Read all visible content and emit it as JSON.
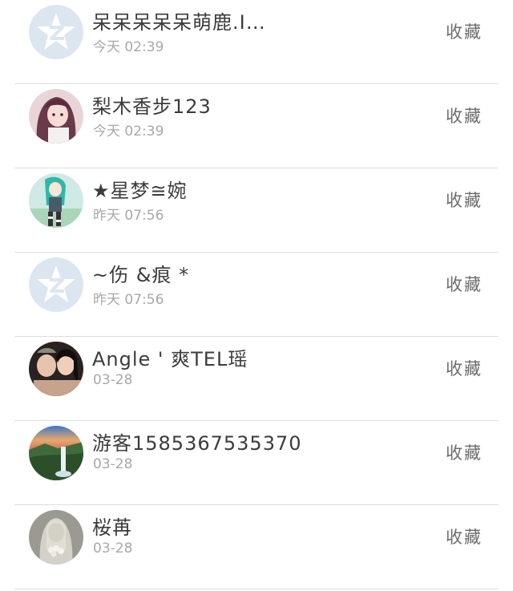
{
  "collect_label": "收藏",
  "users": [
    {
      "name": "呆呆呆呆呆萌鹿.I…",
      "time": "今天 02:39",
      "avatar_icon": "default-qzone-avatar-icon"
    },
    {
      "name": "梨木香步123",
      "time": "今天 02:39",
      "avatar_icon": "anime-girl-avatar"
    },
    {
      "name": "★星梦≅婉",
      "time": "昨天 07:56",
      "avatar_icon": "anime-girl-teal-avatar"
    },
    {
      "name": "~伤 &痕 *",
      "time": "昨天 07:56",
      "avatar_icon": "default-qzone-avatar-icon"
    },
    {
      "name": "Angle ' 爽TEL瑶",
      "time": "03-28",
      "avatar_icon": "two-girls-photo-avatar"
    },
    {
      "name": "游客1585367535370",
      "time": "03-28",
      "avatar_icon": "waterfall-landscape-avatar"
    },
    {
      "name": "桜苒",
      "time": "03-28",
      "avatar_icon": "girl-with-flowers-photo-avatar"
    }
  ],
  "colors": {
    "default_avatar_bg": "#dbe6f1",
    "default_avatar_star": "#ffffff"
  }
}
